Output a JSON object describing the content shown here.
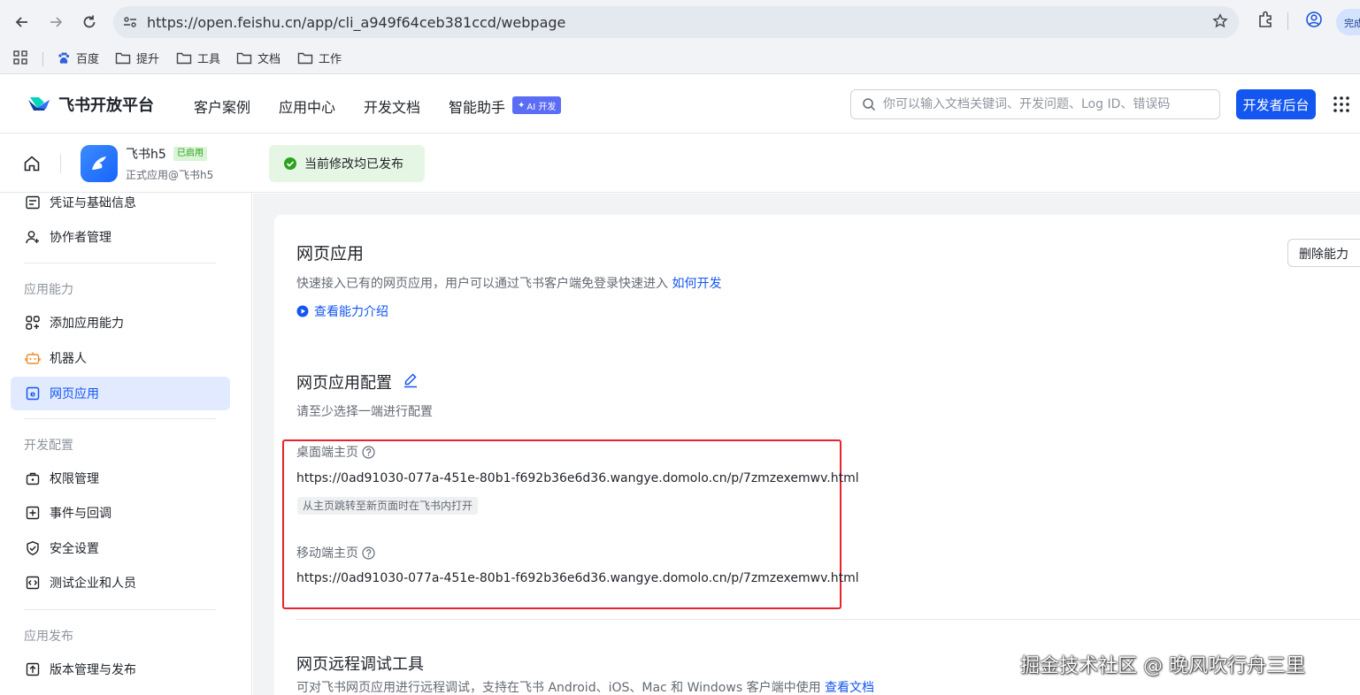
{
  "browser": {
    "url": "https://open.feishu.cn/app/cli_a949f64ceb381ccd/webpage",
    "profile_label": "完成",
    "bookmarks": [
      "百度",
      "提升",
      "工具",
      "文档",
      "工作"
    ]
  },
  "header": {
    "logo_text": "飞书开放平台",
    "nav": [
      "客户案例",
      "应用中心",
      "开发文档",
      "智能助手"
    ],
    "ai_badge": "AI 开发",
    "search_placeholder": "你可以输入文档关键词、开发问题、Log ID、错误码",
    "dev_button": "开发者后台"
  },
  "app_bar": {
    "app_name": "飞书h5",
    "enabled_badge": "已启用",
    "app_org": "正式应用@飞书h5",
    "publish_status": "当前修改均已发布"
  },
  "sidebar": {
    "top_items": [
      "凭证与基础信息",
      "协作者管理"
    ],
    "groups": [
      {
        "title": "应用能力",
        "items": [
          "添加应用能力",
          "机器人",
          "网页应用"
        ]
      },
      {
        "title": "开发配置",
        "items": [
          "权限管理",
          "事件与回调",
          "安全设置",
          "测试企业和人员"
        ]
      },
      {
        "title": "应用发布",
        "items": [
          "版本管理与发布"
        ]
      }
    ],
    "active_item": "网页应用"
  },
  "main": {
    "title": "网页应用",
    "description": "快速接入已有的网页应用，用户可以通过飞书客户端免登录快速进入",
    "how_to_link": "如何开发",
    "intro_link": "查看能力介绍",
    "delete_button": "删除能力",
    "config_title": "网页应用配置",
    "config_subtitle": "请至少选择一端进行配置",
    "desktop_label": "桌面端主页",
    "desktop_url": "https://0ad91030-077a-451e-80b1-f692b36e6d36.wangye.domolo.cn/p/7zmzexemwv.html",
    "desktop_tag": "从主页跳转至新页面时在飞书内打开",
    "mobile_label": "移动端主页",
    "mobile_url": "https://0ad91030-077a-451e-80b1-f692b36e6d36.wangye.domolo.cn/p/7zmzexemwv.html",
    "debug_title": "网页远程调试工具",
    "debug_desc": "可对飞书网页应用进行远程调试，支持在飞书 Android、iOS、Mac 和 Windows 客户端中使用",
    "debug_link": "查看文档"
  },
  "watermark": "掘金技术社区 @ 晚风吹行舟三里",
  "colors": {
    "accent": "#1456f0",
    "highlight_box": "#e8232c",
    "success": "#2ea121"
  }
}
